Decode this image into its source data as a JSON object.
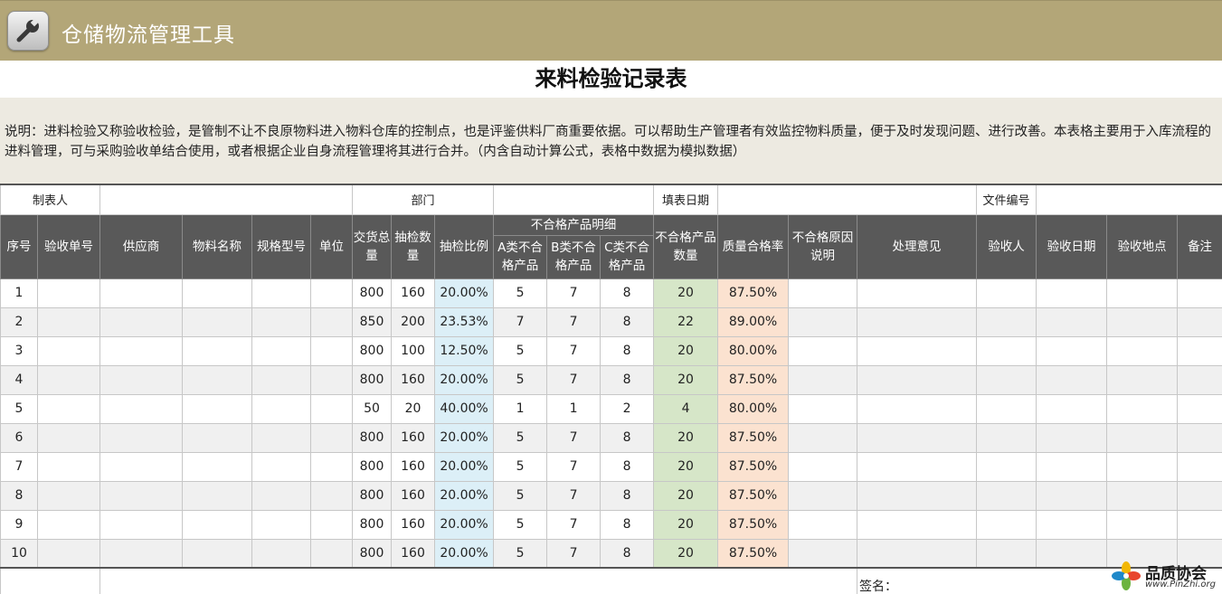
{
  "app": {
    "title": "仓储物流管理工具",
    "icon": "wrench-icon"
  },
  "sheet": {
    "title": "来料检验记录表",
    "description": "说明：进料检验又称验收检验，是管制不让不良原物料进入物料仓库的控制点，也是评鉴供料厂商重要依据。可以帮助生产管理者有效监控物料质量，便于及时发现问题、进行改善。本表格主要用于入库流程的进料管理，可与采购验收单结合使用，或者根据企业自身流程管理将其进行合并。（内含自动计算公式，表格中数据为模拟数据）"
  },
  "meta": {
    "preparer_label": "制表人",
    "dept_label": "部门",
    "date_label": "填表日期",
    "docno_label": "文件编号"
  },
  "headers": {
    "seq": "序号",
    "order_no": "验收单号",
    "supplier": "供应商",
    "material": "物料名称",
    "spec": "规格型号",
    "unit": "单位",
    "delivered": "交货总量",
    "sampled": "抽检数量",
    "ratio": "抽检比例",
    "defect_group": "不合格产品明细",
    "defect_a": "A类不合格产品",
    "defect_b": "B类不合格产品",
    "defect_c": "C类不合格产品",
    "defect_total": "不合格产品数量",
    "pass_rate": "质量合格率",
    "reason": "不合格原因说明",
    "opinion": "处理意见",
    "inspector": "验收人",
    "inspect_date": "验收日期",
    "location": "验收地点",
    "remark": "备注"
  },
  "rows": [
    {
      "seq": "1",
      "delivered": "800",
      "sampled": "160",
      "ratio": "20.00%",
      "a": "5",
      "b": "7",
      "c": "8",
      "total": "20",
      "rate": "87.50%"
    },
    {
      "seq": "2",
      "delivered": "850",
      "sampled": "200",
      "ratio": "23.53%",
      "a": "7",
      "b": "7",
      "c": "8",
      "total": "22",
      "rate": "89.00%"
    },
    {
      "seq": "3",
      "delivered": "800",
      "sampled": "100",
      "ratio": "12.50%",
      "a": "5",
      "b": "7",
      "c": "8",
      "total": "20",
      "rate": "80.00%"
    },
    {
      "seq": "4",
      "delivered": "800",
      "sampled": "160",
      "ratio": "20.00%",
      "a": "5",
      "b": "7",
      "c": "8",
      "total": "20",
      "rate": "87.50%"
    },
    {
      "seq": "5",
      "delivered": "50",
      "sampled": "20",
      "ratio": "40.00%",
      "a": "1",
      "b": "1",
      "c": "2",
      "total": "4",
      "rate": "80.00%"
    },
    {
      "seq": "6",
      "delivered": "800",
      "sampled": "160",
      "ratio": "20.00%",
      "a": "5",
      "b": "7",
      "c": "8",
      "total": "20",
      "rate": "87.50%"
    },
    {
      "seq": "7",
      "delivered": "800",
      "sampled": "160",
      "ratio": "20.00%",
      "a": "5",
      "b": "7",
      "c": "8",
      "total": "20",
      "rate": "87.50%"
    },
    {
      "seq": "8",
      "delivered": "800",
      "sampled": "160",
      "ratio": "20.00%",
      "a": "5",
      "b": "7",
      "c": "8",
      "total": "20",
      "rate": "87.50%"
    },
    {
      "seq": "9",
      "delivered": "800",
      "sampled": "160",
      "ratio": "20.00%",
      "a": "5",
      "b": "7",
      "c": "8",
      "total": "20",
      "rate": "87.50%"
    },
    {
      "seq": "10",
      "delivered": "800",
      "sampled": "160",
      "ratio": "20.00%",
      "a": "5",
      "b": "7",
      "c": "8",
      "total": "20",
      "rate": "87.50%"
    }
  ],
  "footer": {
    "signature_label": "签名："
  },
  "watermark": {
    "name": "品质协会",
    "url": "www.PinZhi.org"
  },
  "colors": {
    "banner": "#b3a678",
    "header": "#595959",
    "ratio": "#dceff7",
    "defect_total": "#d6e6c8",
    "pass_rate": "#fbe2d0"
  }
}
